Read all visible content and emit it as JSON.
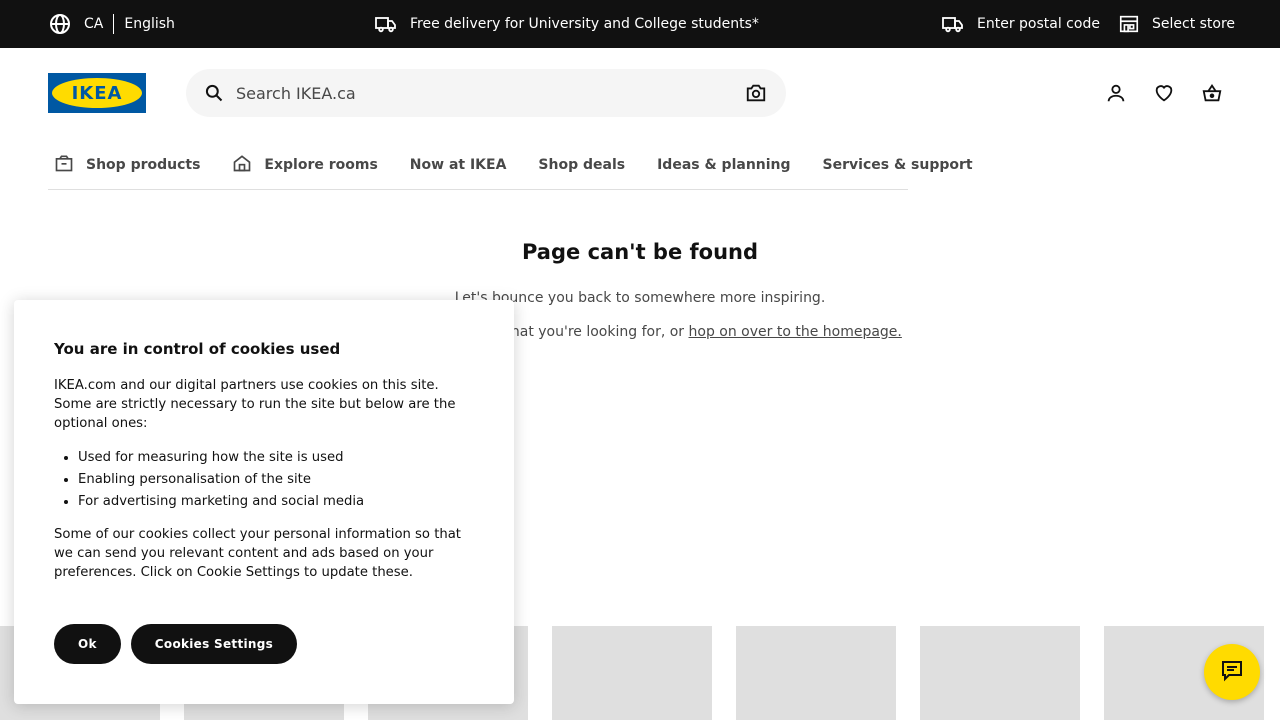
{
  "topbar": {
    "country": "CA",
    "language": "English",
    "delivery_text": "Free delivery for University and College students*",
    "postal_text": "Enter postal code",
    "store_text": "Select store",
    "icons": [
      "globe-icon",
      "truck-icon",
      "truck-icon",
      "store-icon"
    ]
  },
  "header": {
    "logo_text": "IKEA",
    "search_placeholder": "Search IKEA.ca",
    "icons": [
      "search-icon",
      "camera-icon",
      "account-icon",
      "heart-icon",
      "basket-icon"
    ]
  },
  "nav": {
    "items": [
      {
        "label": "Shop products",
        "icon": "box-icon"
      },
      {
        "label": "Explore rooms",
        "icon": "house-icon"
      },
      {
        "label": "Now at IKEA"
      },
      {
        "label": "Shop deals"
      },
      {
        "label": "Ideas & planning"
      },
      {
        "label": "Services & support"
      }
    ]
  },
  "main": {
    "title": "Page can't be found",
    "line1": "Let's bounce you back to somewhere more inspiring.",
    "line2_prefix": "Try searching for what you're looking for, or",
    "line2_link": "hop on over to the homepage."
  },
  "cookie": {
    "title": "You are in control of cookies used",
    "intro": "IKEA.com and our digital partners use cookies on this site. Some are strictly necessary to run the site but below are the optional ones:",
    "items": [
      "Used for measuring how the site is used",
      "Enabling personalisation of the site",
      "For advertising marketing and social media"
    ],
    "outro": "Some of our cookies collect your personal information so that we can send you relevant content and ads based on your preferences. Click on Cookie Settings to update these.",
    "ok_label": "Ok",
    "settings_label": "Cookies Settings"
  },
  "colors": {
    "topbar_bg": "#111111",
    "brand_blue": "#0058a3",
    "brand_yellow": "#ffdb00",
    "tile_gray": "#dfdfdf"
  }
}
